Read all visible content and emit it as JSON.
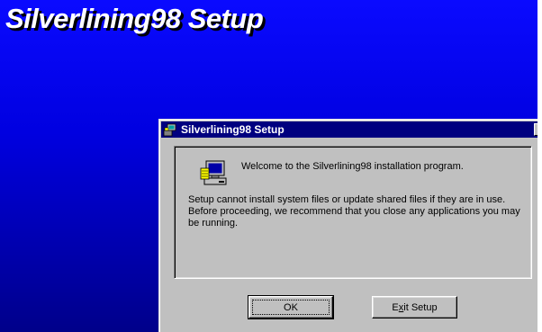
{
  "background": {
    "heading": "Silverlining98 Setup",
    "gradient_top": "#0a0aff",
    "gradient_bottom": "#00008a"
  },
  "dialog": {
    "title": "Silverlining98 Setup",
    "title_icon": "setup-computer-icon",
    "close_label": "×",
    "welcome": "Welcome to the Silverlining98 installation program.",
    "warning": "Setup cannot install system files or update shared files if they are in use. Before proceeding, we recommend that you close any applications you may be running.",
    "content_icon": "computer-icon",
    "buttons": {
      "ok_label": "OK",
      "exit_label_pre": "E",
      "exit_label_mnemonic": "x",
      "exit_label_post": "it Setup"
    }
  },
  "colors": {
    "titlebar": "#000080",
    "face": "#c0c0c0"
  }
}
